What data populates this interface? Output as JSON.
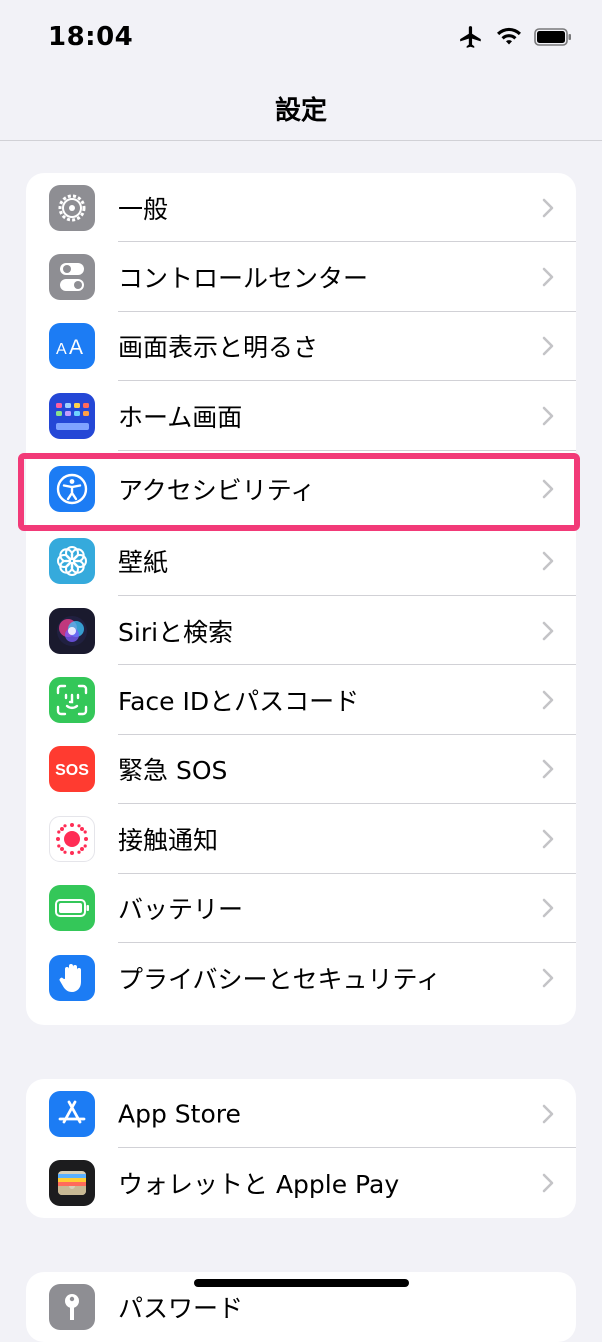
{
  "status_bar": {
    "time": "18:04"
  },
  "header": {
    "title": "設定"
  },
  "group1": [
    {
      "label": "一般",
      "icon": "gear-icon",
      "color": "#8e8e93"
    },
    {
      "label": "コントロールセンター",
      "icon": "toggles-icon",
      "color": "#8e8e93"
    },
    {
      "label": "画面表示と明るさ",
      "icon": "text-size-icon",
      "color": "#1c7cf4"
    },
    {
      "label": "ホーム画面",
      "icon": "home-grid-icon",
      "color": "#2447d6"
    },
    {
      "label": "アクセシビリティ",
      "icon": "accessibility-icon",
      "color": "#1c7cf4"
    },
    {
      "label": "壁紙",
      "icon": "flower-icon",
      "color": "#35aadc"
    },
    {
      "label": "Siriと検索",
      "icon": "siri-icon",
      "color": "#1a1a2e"
    },
    {
      "label": "Face IDとパスコード",
      "icon": "face-id-icon",
      "color": "#34c759"
    },
    {
      "label": "緊急 SOS",
      "icon": "sos-icon",
      "color": "#ff3b30"
    },
    {
      "label": "接触通知",
      "icon": "exposure-icon",
      "color": "#ffffff"
    },
    {
      "label": "バッテリー",
      "icon": "battery-icon",
      "color": "#34c759"
    },
    {
      "label": "プライバシーとセキュリティ",
      "icon": "hand-icon",
      "color": "#1c7cf4"
    }
  ],
  "group2": [
    {
      "label": "App Store",
      "icon": "app-store-icon",
      "color": "#1c7cf4"
    },
    {
      "label": "ウォレットと Apple Pay",
      "icon": "wallet-icon",
      "color": "#1c1c1e"
    }
  ],
  "group3": [
    {
      "label": "パスワード",
      "icon": "key-icon",
      "color": "#8e8e93"
    }
  ],
  "highlight_color": "#f23a78"
}
